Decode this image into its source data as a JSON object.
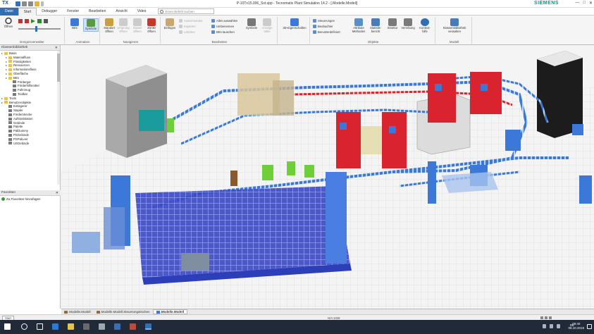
{
  "app": {
    "logo": "TX",
    "title": "P-10Tx15.006_Sxt.spp - Tecnomatix Plant Simulation 14.2 - [.Modelle.Modell]",
    "brand": "SIEMENS",
    "window_controls": [
      "—",
      "□",
      "✕"
    ]
  },
  "tabs": [
    "Datei",
    "Start",
    "Debugger",
    "Fenster",
    "Bearbeiten",
    "Ansicht",
    "Video"
  ],
  "active_tab": "Start",
  "search": {
    "placeholder": "Einen Befehl suchen"
  },
  "ribbon": {
    "groups": [
      {
        "label": "Ereignisverwalter",
        "buttons": [
          "Öffnen"
        ]
      },
      {
        "label": "Animation",
        "buttons": [
          "BEs",
          "Symbole"
        ]
      },
      {
        "label": "Navigieren",
        "buttons": [
          "Standort öffnen",
          "Ursprung öffnen",
          "Klasse öffnen",
          "2D/3D öffnen"
        ]
      },
      {
        "label": "Bearbeiten",
        "buttons": [
          "Einfügen",
          "Symbole",
          "Anzeige table"
        ],
        "small": [
          "Ausschneiden",
          "Kopieren",
          "Löschen",
          "Alles auswählen",
          "Umbenennen",
          "BEs tauschen"
        ]
      },
      {
        "label": "",
        "buttons": [
          "3D-Eigenschaften"
        ]
      },
      {
        "label": "Objekte",
        "buttons": [
          "Attribute Methoden",
          "Statistik-bericht",
          "Struktur",
          "Vererbung",
          "Kontext-hilfe"
        ],
        "small": [
          "Steuerungen",
          "Beobachter",
          "Benutzerdefiniert"
        ]
      },
      {
        "label": "Modell",
        "buttons": [
          "Klassenbibliothek verwalten"
        ]
      }
    ]
  },
  "class_library": {
    "title": "Klassenbibliothek",
    "items": [
      {
        "label": "Basis",
        "type": "folder",
        "level": 0
      },
      {
        "label": "Materialfluss",
        "type": "folder",
        "level": 1
      },
      {
        "label": "Flüssigkeiten",
        "type": "folder",
        "level": 1
      },
      {
        "label": "Ressourcen",
        "type": "folder",
        "level": 1
      },
      {
        "label": "Informationsfluss",
        "type": "folder",
        "level": 1
      },
      {
        "label": "Oberfläche",
        "type": "folder",
        "level": 1
      },
      {
        "label": "BEs",
        "type": "folder",
        "level": 1
      },
      {
        "label": "Fördergut",
        "type": "object",
        "level": 2
      },
      {
        "label": "Förderhilfsmittel",
        "type": "object",
        "level": 2
      },
      {
        "label": "Fahrzeug",
        "type": "object",
        "level": 2
      },
      {
        "label": "Toolbar",
        "type": "object",
        "level": 2
      },
      {
        "label": "Tools",
        "type": "folder",
        "level": 0
      },
      {
        "label": "Benutzerobjekte",
        "type": "folder",
        "level": 0
      },
      {
        "label": "Einlagerer",
        "type": "object",
        "level": 1
      },
      {
        "label": "Stapler",
        "type": "object",
        "level": 1
      },
      {
        "label": "Förderstrecke",
        "type": "object",
        "level": 1
      },
      {
        "label": "Auftraststation",
        "type": "object",
        "level": 1
      },
      {
        "label": "Gebinde",
        "type": "object",
        "level": 1
      },
      {
        "label": "Palette",
        "type": "object",
        "level": 1
      },
      {
        "label": "PalDummy",
        "type": "object",
        "level": 1
      },
      {
        "label": "PSGebinde",
        "type": "object",
        "level": 1
      },
      {
        "label": "PSPalLeer",
        "type": "object",
        "level": 1
      },
      {
        "label": "USGebinde",
        "type": "object",
        "level": 1
      }
    ]
  },
  "favorites": {
    "title": "Favoriten",
    "add_label": "Zu Favoriten hinzufügen"
  },
  "doc_tabs": [
    ".Modelle.Modell",
    ".Modelle.Modell.Steuerungstischen",
    ".Modelle.Modell"
  ],
  "active_doc_tab": 2,
  "status": {
    "left": "Start",
    "middle": "N/A:1028"
  },
  "taskbar": {
    "lang": "DE",
    "time": "09:40",
    "date": "08.10.2019"
  },
  "colors": {
    "accent": "#2f6fb3",
    "conveyor_blue": "#3b78d8",
    "red_units": "#d9232e",
    "shelf_blue": "#2d3fb8",
    "taskbar": "#202a38"
  }
}
